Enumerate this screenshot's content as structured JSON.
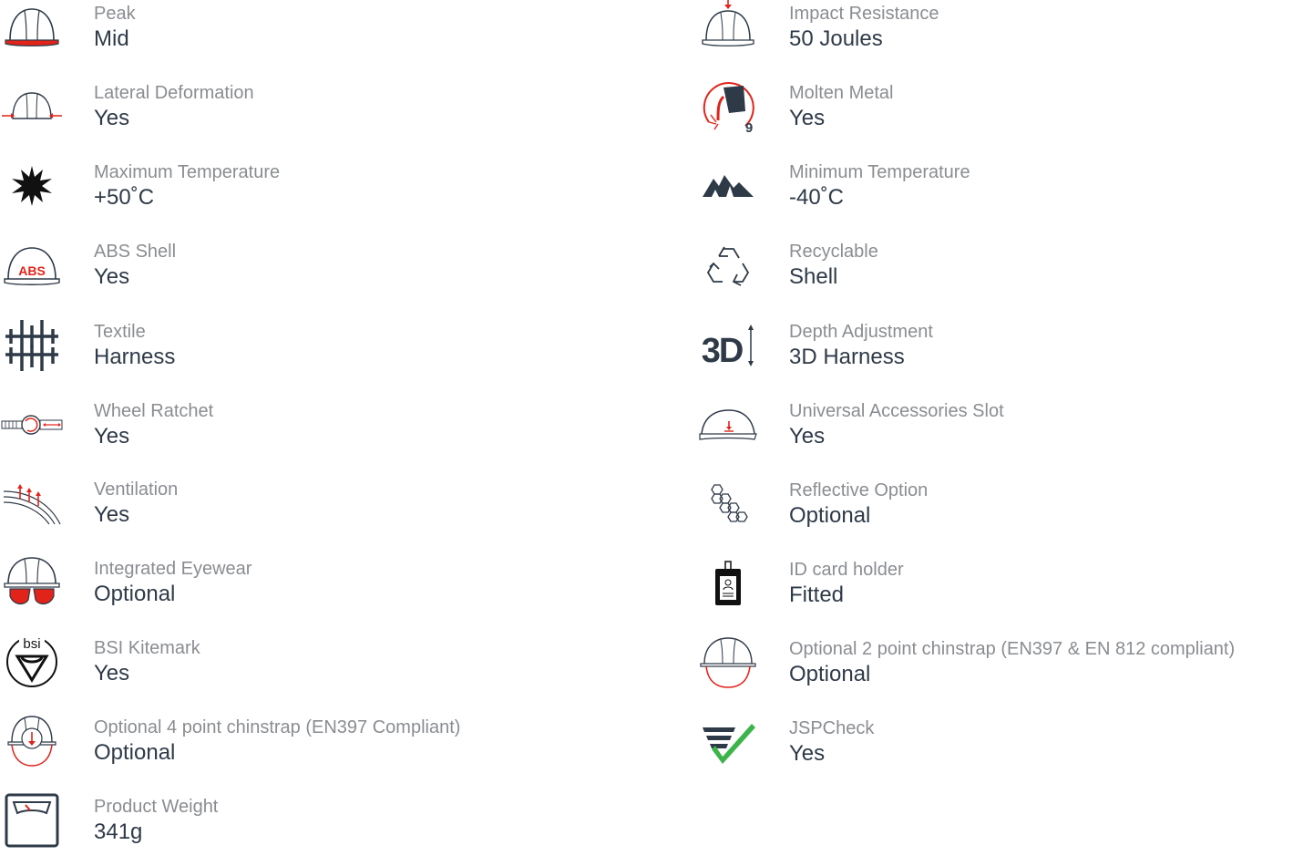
{
  "colors": {
    "label": "#8a8d91",
    "value": "#2f3a48",
    "icon_dark": "#2f3a48",
    "accent_red": "#e2231a",
    "check_green": "#3cb44a"
  },
  "left_features": [
    {
      "icon": "helmet-peak-icon",
      "label": "Peak",
      "value": "Mid"
    },
    {
      "icon": "lateral-deformation-icon",
      "label": "Lateral Deformation",
      "value": "Yes"
    },
    {
      "icon": "sun-icon",
      "label": "Maximum Temperature",
      "value": "+50˚C"
    },
    {
      "icon": "abs-shell-icon",
      "label": "ABS Shell",
      "value": "Yes"
    },
    {
      "icon": "textile-grid-icon",
      "label": "Textile",
      "value": "Harness"
    },
    {
      "icon": "wheel-ratchet-icon",
      "label": "Wheel Ratchet",
      "value": "Yes"
    },
    {
      "icon": "ventilation-icon",
      "label": "Ventilation",
      "value": "Yes"
    },
    {
      "icon": "eyewear-helmet-icon",
      "label": "Integrated Eyewear",
      "value": "Optional"
    },
    {
      "icon": "bsi-kitemark-icon",
      "label": "BSI Kitemark",
      "value": "Yes"
    },
    {
      "icon": "chinstrap-4-point-icon",
      "label": "Optional 4 point chinstrap (EN397 Compliant)",
      "value": "Optional"
    },
    {
      "icon": "weighing-scale-icon",
      "label": "Product Weight",
      "value": "341g"
    }
  ],
  "right_features": [
    {
      "icon": "impact-helmet-icon",
      "label": "Impact Resistance",
      "value": "50 Joules"
    },
    {
      "icon": "molten-metal-icon",
      "label": "Molten Metal",
      "value": "Yes",
      "icon_text": "9"
    },
    {
      "icon": "mountains-icon",
      "label": "Minimum Temperature",
      "value": "-40˚C"
    },
    {
      "icon": "recycle-icon",
      "label": "Recyclable",
      "value": "Shell"
    },
    {
      "icon": "depth-3d-icon",
      "label": "Depth Adjustment",
      "value": "3D Harness",
      "icon_text": "3D"
    },
    {
      "icon": "accessory-slot-icon",
      "label": "Universal Accessories Slot",
      "value": "Yes"
    },
    {
      "icon": "hexagons-icon",
      "label": "Reflective Option",
      "value": "Optional"
    },
    {
      "icon": "id-card-icon",
      "label": "ID card holder",
      "value": "Fitted"
    },
    {
      "icon": "chinstrap-2-point-icon",
      "label": "Optional 2 point chinstrap (EN397 & EN 812 compliant)",
      "value": "Optional"
    },
    {
      "icon": "jspcheck-icon",
      "label": "JSPCheck",
      "value": "Yes"
    }
  ],
  "icon_texts": {
    "abs": "ABS",
    "bsi": "bsi"
  }
}
